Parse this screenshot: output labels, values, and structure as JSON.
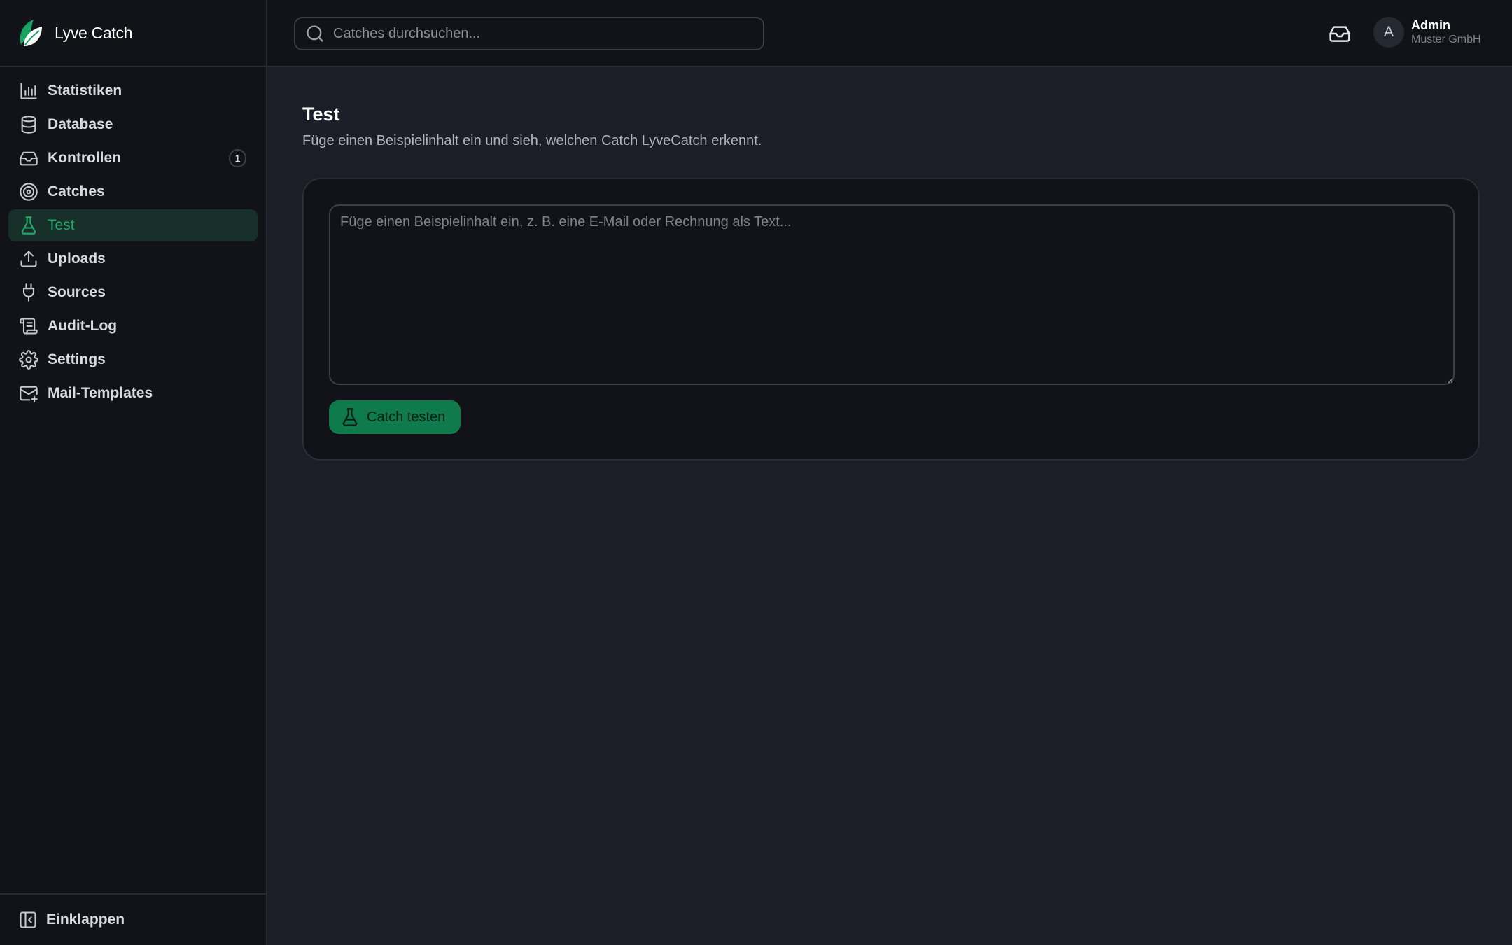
{
  "app": {
    "name": "Lyve Catch"
  },
  "colors": {
    "accent": "#22a86b",
    "button": "#0f7a4c",
    "sidebar_bg": "#111318",
    "main_bg": "#1b1e26"
  },
  "search": {
    "placeholder": "Catches durchsuchen..."
  },
  "header": {
    "inbox_icon": "inbox-icon",
    "user": {
      "avatar_initial": "A",
      "name": "Admin",
      "org": "Muster GmbH"
    }
  },
  "sidebar": {
    "items": [
      {
        "label": "Statistiken",
        "icon": "bar-chart-icon"
      },
      {
        "label": "Database",
        "icon": "database-icon"
      },
      {
        "label": "Kontrollen",
        "icon": "inbox-icon",
        "badge": "1"
      },
      {
        "label": "Catches",
        "icon": "target-icon"
      },
      {
        "label": "Test",
        "icon": "flask-icon",
        "active": true
      },
      {
        "label": "Uploads",
        "icon": "upload-icon"
      },
      {
        "label": "Sources",
        "icon": "plug-icon"
      },
      {
        "label": "Audit-Log",
        "icon": "scroll-icon"
      },
      {
        "label": "Settings",
        "icon": "gear-icon"
      },
      {
        "label": "Mail-Templates",
        "icon": "mail-plus-icon"
      }
    ],
    "footer": {
      "label": "Einklappen",
      "icon": "collapse-panel-icon"
    }
  },
  "main": {
    "title": "Test",
    "subtitle": "Füge einen Beispielinhalt ein und sieh, welchen Catch LyveCatch erkennt.",
    "input": {
      "placeholder": "Füge einen Beispielinhalt ein, z. B. eine E-Mail oder Rechnung als Text...",
      "value": ""
    },
    "button": {
      "label": "Catch testen",
      "icon": "flask-icon"
    }
  }
}
